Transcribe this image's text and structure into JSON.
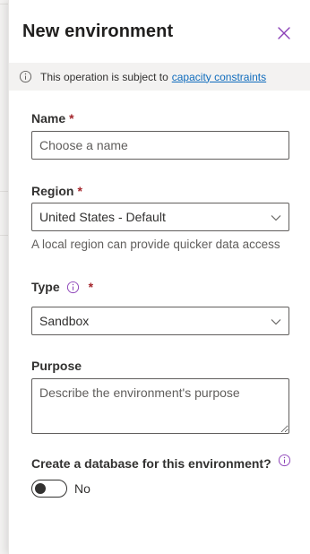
{
  "panel": {
    "title": "New environment",
    "close_icon": "close-icon"
  },
  "message_bar": {
    "text": "This operation is subject to",
    "link": "capacity constraints",
    "icon": "info-icon"
  },
  "form": {
    "name": {
      "label": "Name",
      "required_mark": "*",
      "placeholder": "Choose a name",
      "value": ""
    },
    "region": {
      "label": "Region",
      "required_mark": "*",
      "selected": "United States - Default",
      "hint": "A local region can provide quicker data access"
    },
    "type": {
      "label": "Type",
      "required_mark": "*",
      "selected": "Sandbox",
      "info_icon": "info-icon"
    },
    "purpose": {
      "label": "Purpose",
      "placeholder": "Describe the environment's purpose",
      "value": ""
    },
    "database": {
      "label": "Create a database for this environment?",
      "info_icon": "info-icon",
      "toggle_state": "No"
    }
  },
  "colors": {
    "accent_purple": "#8a3fb7",
    "link_blue": "#0f6cbd",
    "required_red": "#a4262c",
    "message_bar_bg": "#f3f2f1"
  }
}
